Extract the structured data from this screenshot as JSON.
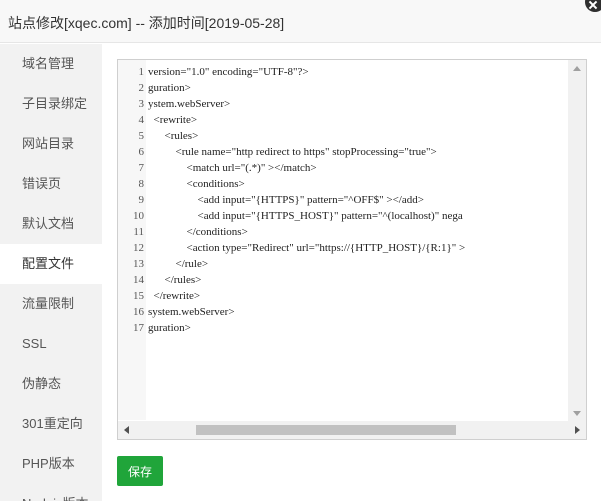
{
  "window": {
    "title": "站点修改[xqec.com] -- 添加时间[2019-05-28]"
  },
  "sidebar": {
    "items": [
      {
        "label": "域名管理"
      },
      {
        "label": "子目录绑定"
      },
      {
        "label": "网站目录"
      },
      {
        "label": "错误页"
      },
      {
        "label": "默认文档"
      },
      {
        "label": "配置文件",
        "active": true
      },
      {
        "label": "流量限制"
      },
      {
        "label": "SSL"
      },
      {
        "label": "伪静态"
      },
      {
        "label": "301重定向"
      },
      {
        "label": "PHP版本"
      },
      {
        "label": "Nodejs版本"
      }
    ]
  },
  "editor": {
    "lines": [
      {
        "n": "1",
        "text": "version=\"1.0\" encoding=\"UTF-8\"?>"
      },
      {
        "n": "2",
        "text": "guration>"
      },
      {
        "n": "3",
        "text": "ystem.webServer>"
      },
      {
        "n": "4",
        "text": "  <rewrite>"
      },
      {
        "n": "5",
        "text": "      <rules>"
      },
      {
        "n": "6",
        "text": "          <rule name=\"http redirect to https\" stopProcessing=\"true\">"
      },
      {
        "n": "7",
        "text": "              <match url=\"(.*)\" ></match>"
      },
      {
        "n": "8",
        "text": "              <conditions>"
      },
      {
        "n": "9",
        "text": "                  <add input=\"{HTTPS}\" pattern=\"^OFF$\" ></add>"
      },
      {
        "n": "10",
        "text": "                  <add input=\"{HTTPS_HOST}\" pattern=\"^(localhost)\" nega"
      },
      {
        "n": "11",
        "text": "              </conditions>"
      },
      {
        "n": "12",
        "text": "              <action type=\"Redirect\" url=\"https://{HTTP_HOST}/{R:1}\" >"
      },
      {
        "n": "13",
        "text": "          </rule>"
      },
      {
        "n": "14",
        "text": "      </rules>"
      },
      {
        "n": "15",
        "text": "  </rewrite>"
      },
      {
        "n": "16",
        "text": "system.webServer>"
      },
      {
        "n": "17",
        "text": "guration>"
      }
    ]
  },
  "actions": {
    "save_label": "保存"
  },
  "colors": {
    "accent": "#20a53a"
  }
}
